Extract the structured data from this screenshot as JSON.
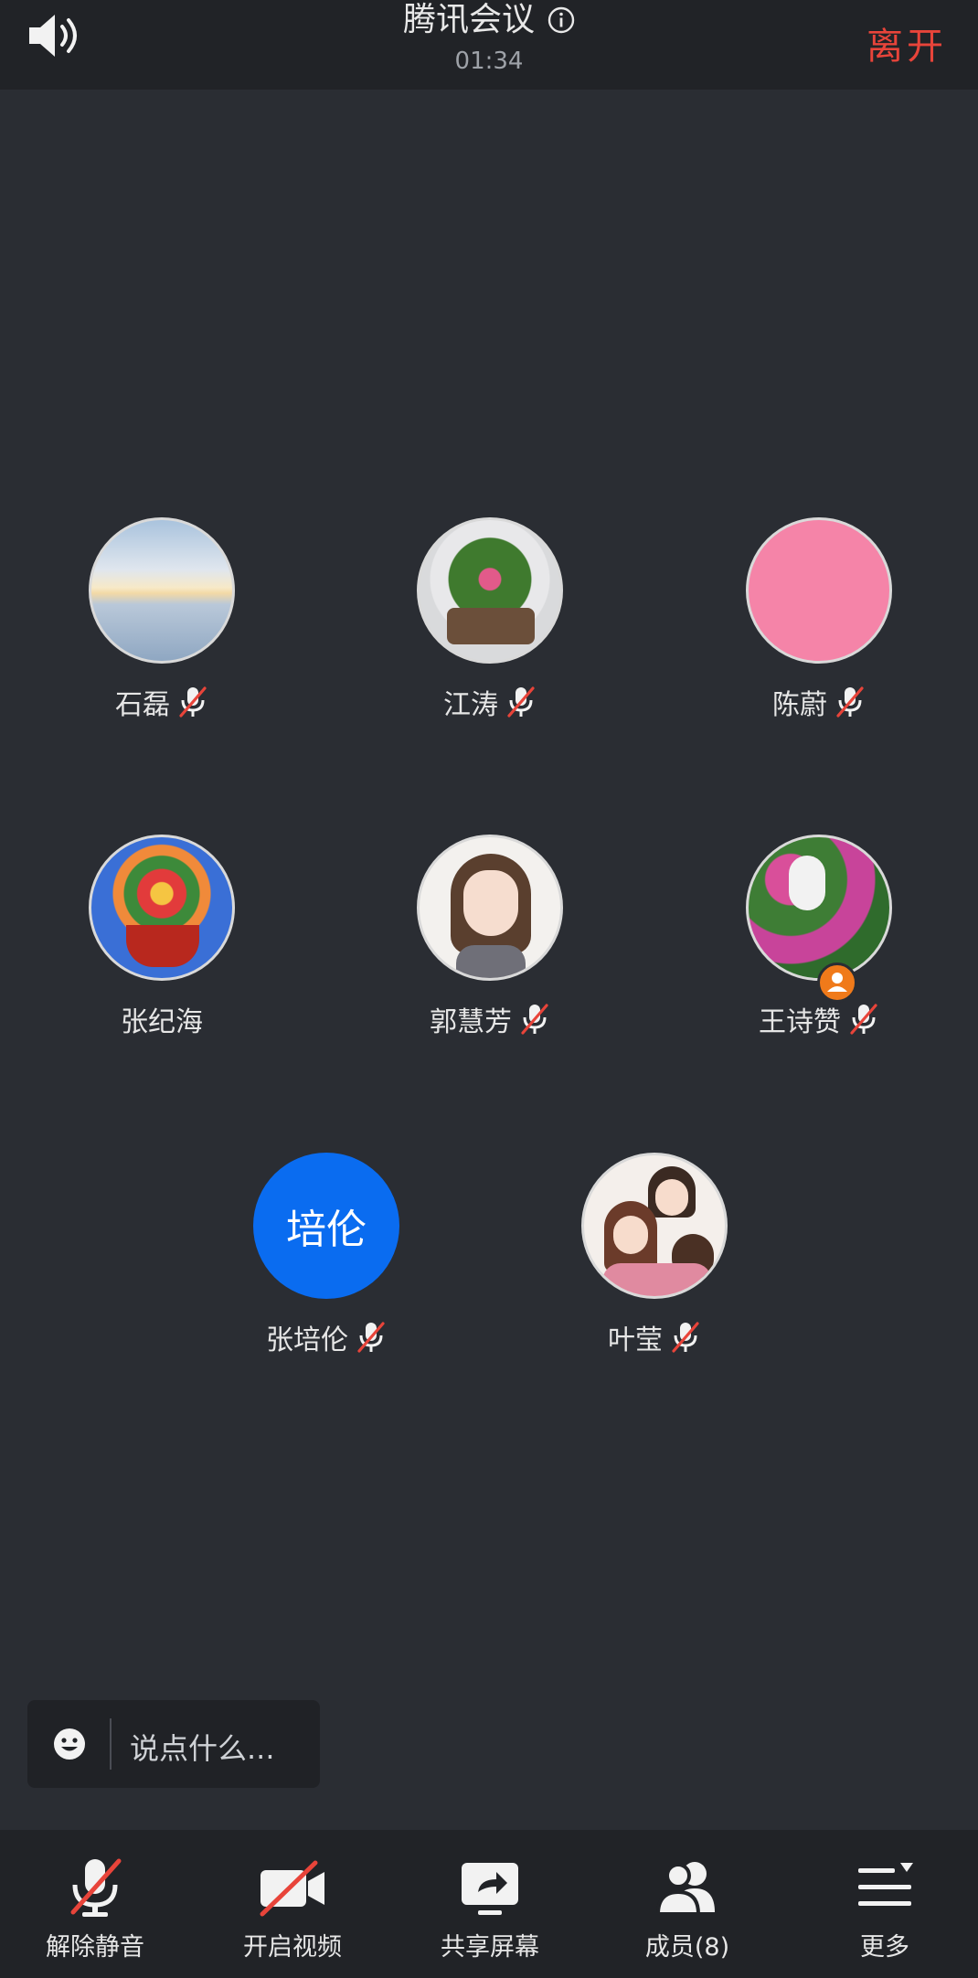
{
  "header": {
    "title": "腾讯会议",
    "timer": "01:34",
    "leave_label": "离开"
  },
  "participants": [
    {
      "name": "石磊",
      "muted": true,
      "avatar": "sunset-photo"
    },
    {
      "name": "江涛",
      "muted": true,
      "avatar": "flower-basket-photo"
    },
    {
      "name": "陈蔚",
      "muted": true,
      "avatar": "pink-circle"
    },
    {
      "name": "张纪海",
      "muted": false,
      "avatar": "flower-basket-red-photo"
    },
    {
      "name": "郭慧芳",
      "muted": true,
      "avatar": "cartoon-girl"
    },
    {
      "name": "王诗赞",
      "muted": true,
      "avatar": "flowers-dog-photo",
      "host": true
    },
    {
      "name": "张培伦",
      "muted": true,
      "avatar": "initials",
      "initials": "培伦"
    },
    {
      "name": "叶莹",
      "muted": true,
      "avatar": "cartoon-family"
    }
  ],
  "chat": {
    "placeholder": "说点什么..."
  },
  "toolbar": {
    "unmute_label": "解除静音",
    "video_label": "开启视频",
    "share_label": "共享屏幕",
    "members_label": "成员(8)",
    "more_label": "更多"
  },
  "colors": {
    "background": "#2a2d33",
    "bar": "#212327",
    "leave": "#e8443a",
    "accent_blue": "#0a6cf0",
    "mute_slash": "#e8443a"
  }
}
